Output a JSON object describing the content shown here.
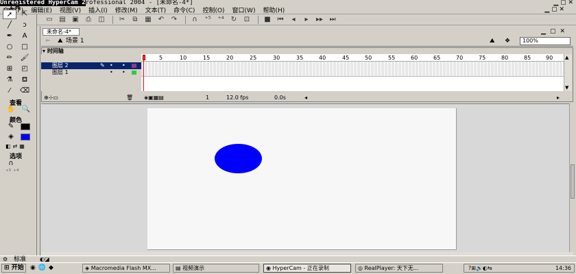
{
  "window": {
    "title_overlay": "Unregistered HyperCam 2",
    "title": "rofessional 2004 - [未命名-4*]"
  },
  "menu": [
    "文件(F)",
    "编辑(E)",
    "视图(V)",
    "插入(I)",
    "修改(M)",
    "文本(T)",
    "命令(C)",
    "控制(O)",
    "窗口(W)",
    "帮助(H)"
  ],
  "tools": {
    "header": "工具",
    "view_label": "查看",
    "colors_label": "颜色",
    "options_label": "选项"
  },
  "document": {
    "tab": "未命名-4*",
    "scene": "场景 1",
    "zoom": "100%"
  },
  "timeline": {
    "header": "时间轴",
    "ruler_ticks": [
      "1",
      "5",
      "10",
      "15",
      "20",
      "25",
      "30",
      "35",
      "40",
      "45",
      "50",
      "55",
      "60",
      "65",
      "70",
      "75",
      "80",
      "85",
      "90"
    ],
    "layers": [
      {
        "name": "图层 2",
        "selected": true,
        "color": "#8b3a8b"
      },
      {
        "name": "图层 1",
        "selected": false,
        "color": "#2ecc40"
      }
    ],
    "current_frame": "1",
    "fps": "12.0 fps",
    "time": "0.0s"
  },
  "stage": {
    "shape_color": "#0000ff"
  },
  "panel_strip": {
    "label": "标准"
  },
  "taskbar": {
    "start": "开始",
    "buttons": [
      "Macromedia Flash MX...",
      "视频演示",
      "HyperCam - 正在录制",
      "RealPlayer: 天下无..."
    ],
    "clock": "14:36"
  }
}
